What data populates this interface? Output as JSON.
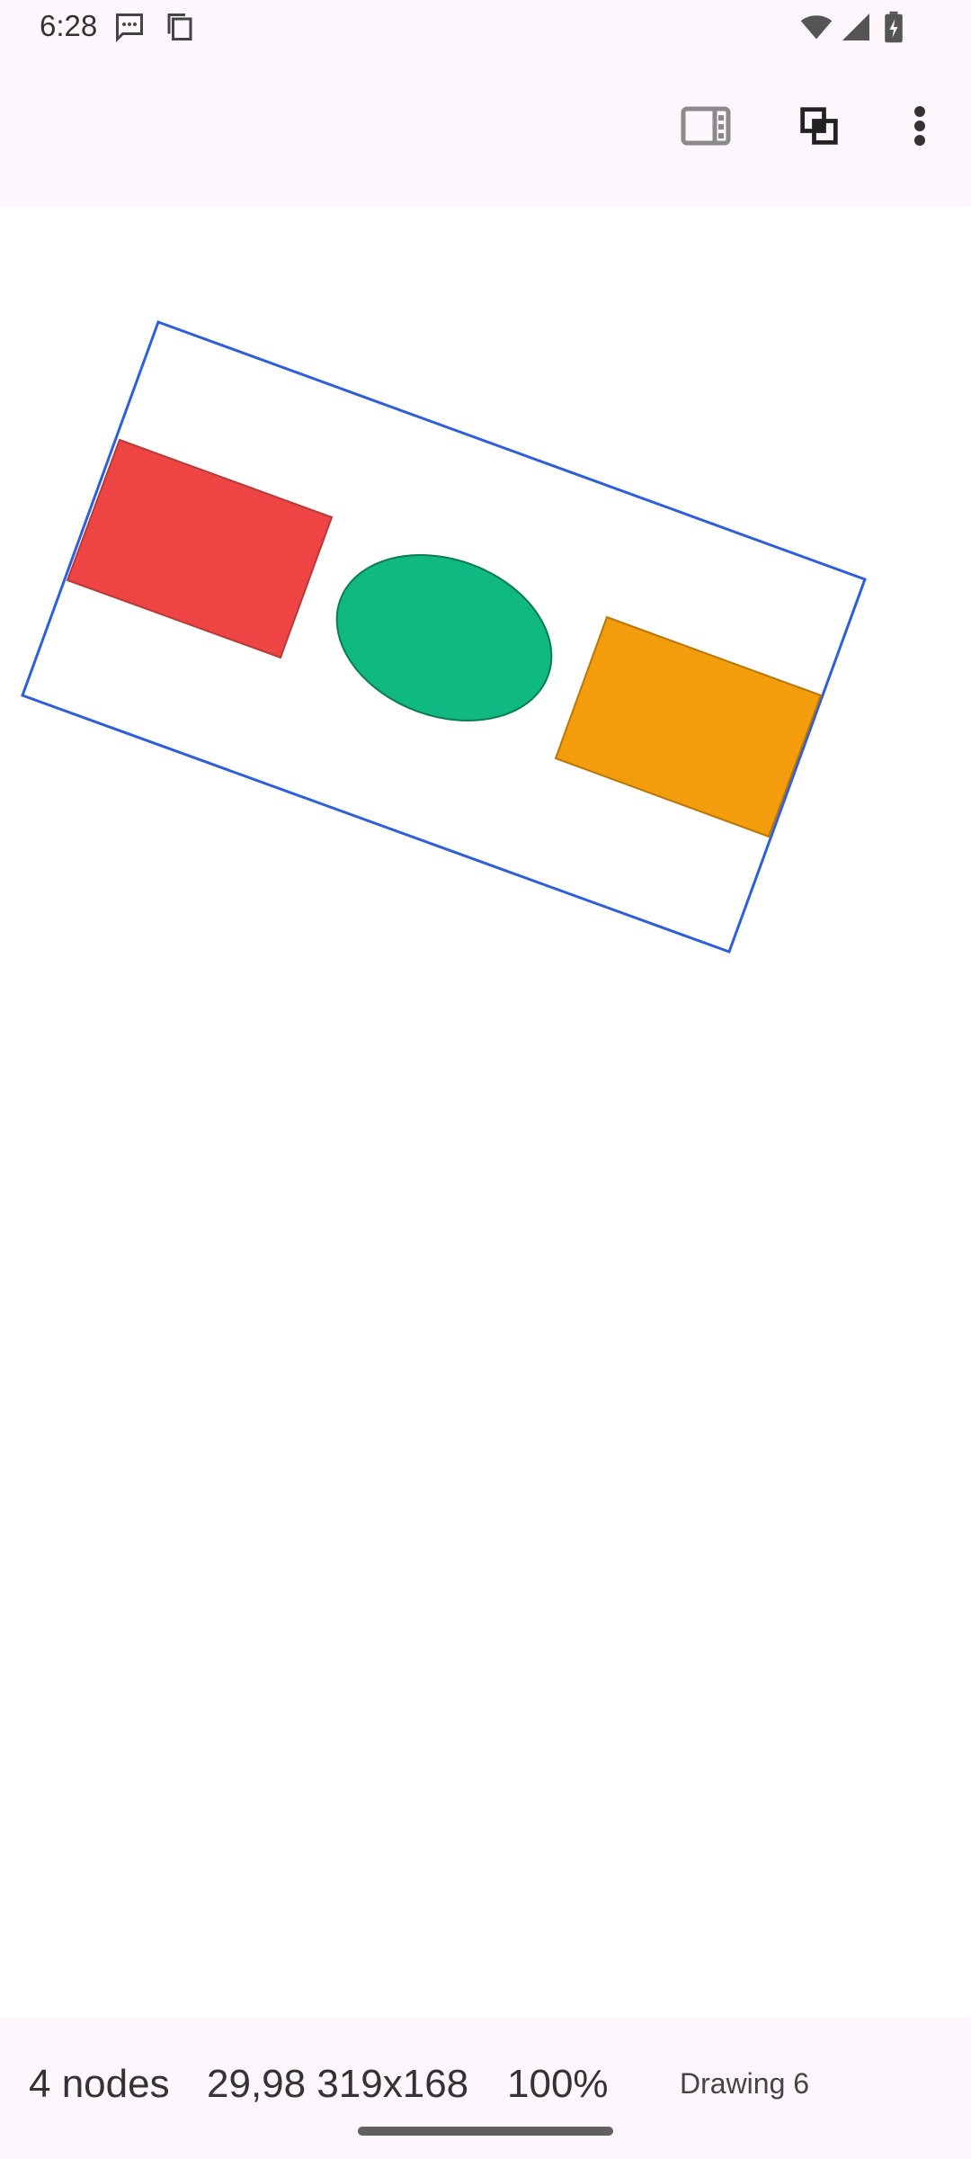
{
  "status_bar": {
    "time": "6:28",
    "icons": [
      "message-icon",
      "copy-icon",
      "wifi-icon",
      "signal-icon",
      "battery-icon"
    ]
  },
  "app_bar": {
    "actions": [
      "panel-toggle-icon",
      "arrange-icon",
      "more-vert-icon"
    ]
  },
  "canvas": {
    "selection_color": "#2f5fd8",
    "shapes": [
      {
        "type": "rectangle",
        "fill": "#ef4444"
      },
      {
        "type": "ellipse",
        "fill": "#10b981"
      },
      {
        "type": "rectangle",
        "fill": "#f39c0c"
      }
    ]
  },
  "info_bar": {
    "nodes": "4 nodes",
    "geometry": "29,98 319x168",
    "zoom": "100%",
    "document": "Drawing 6"
  }
}
